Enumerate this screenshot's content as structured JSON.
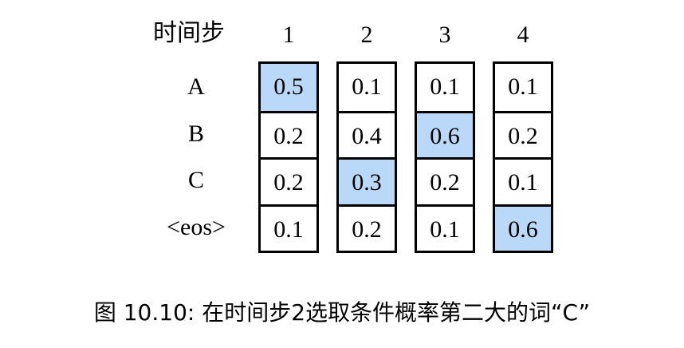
{
  "header_label": "时间步",
  "time_steps": [
    "1",
    "2",
    "3",
    "4"
  ],
  "row_labels": [
    "A",
    "B",
    "C",
    "<eos>"
  ],
  "probabilities": [
    [
      "0.5",
      "0.2",
      "0.2",
      "0.1"
    ],
    [
      "0.1",
      "0.4",
      "0.3",
      "0.2"
    ],
    [
      "0.1",
      "0.6",
      "0.2",
      "0.1"
    ],
    [
      "0.1",
      "0.2",
      "0.1",
      "0.6"
    ]
  ],
  "selected_row_per_step": [
    0,
    2,
    1,
    3
  ],
  "highlight_color": "#bad8f7",
  "caption": "图 10.10: 在时间步2选取条件概率第二大的词“C”"
}
